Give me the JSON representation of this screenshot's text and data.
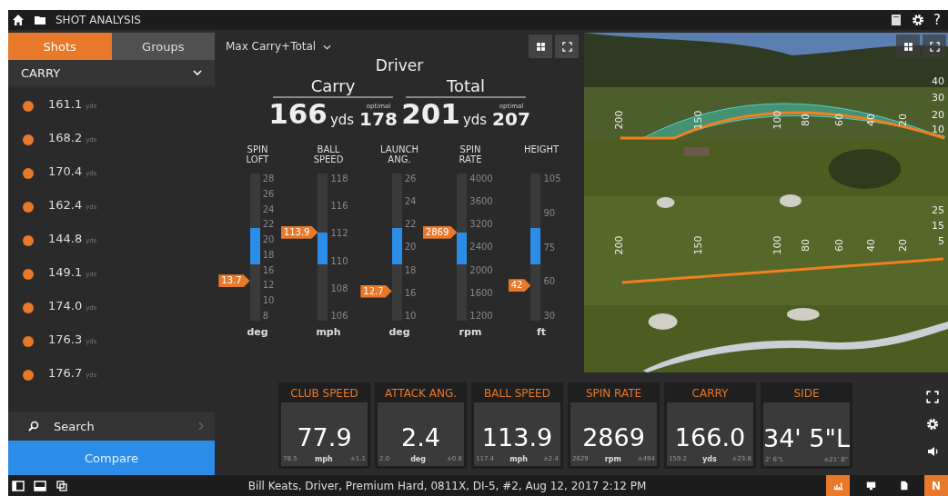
{
  "top_bar": {
    "title": "SHOT ANALYSIS",
    "help": "?"
  },
  "sidebar": {
    "tabs": [
      {
        "label": "Shots",
        "selected": true
      },
      {
        "label": "Groups",
        "selected": false
      }
    ],
    "metric": "CARRY",
    "shots": [
      {
        "value": "161.1",
        "unit": "yds",
        "color": "#e8782a"
      },
      {
        "value": "168.2",
        "unit": "yds",
        "color": "#e8782a"
      },
      {
        "value": "170.4",
        "unit": "yds",
        "color": "#e8782a"
      },
      {
        "value": "162.4",
        "unit": "yds",
        "color": "#e8782a"
      },
      {
        "value": "144.8",
        "unit": "yds",
        "color": "#e8782a"
      },
      {
        "value": "149.1",
        "unit": "yds",
        "color": "#e8782a"
      },
      {
        "value": "174.0",
        "unit": "yds",
        "color": "#e8782a"
      },
      {
        "value": "176.3",
        "unit": "yds",
        "color": "#e8782a"
      },
      {
        "value": "176.7",
        "unit": "yds",
        "color": "#e8782a"
      }
    ],
    "search": "Search",
    "compare": "Compare"
  },
  "analysis": {
    "dropdown": "Max Carry+Total",
    "club": "Driver",
    "results": [
      {
        "label": "Carry",
        "value": "166",
        "unit": "yds",
        "optimal_label": "optimal",
        "optimal": "178"
      },
      {
        "label": "Total",
        "value": "201",
        "unit": "yds",
        "optimal_label": "optimal",
        "optimal": "207"
      }
    ],
    "gauges": [
      {
        "label": "SPIN LOFT",
        "unit": "deg",
        "reading": "13.7",
        "level": 0.27,
        "band_top": {
          "level": 0.63
        },
        "band_bottom": {
          "level": 0.38
        },
        "ticks": [
          "28",
          "26",
          "24",
          "22",
          "20",
          "18",
          "16",
          "12",
          "10",
          "8"
        ]
      },
      {
        "label": "BALL SPEED",
        "unit": "mph",
        "reading": "113.9",
        "level": 0.6,
        "band_top": {
          "level": 0.6
        },
        "band_bottom": {
          "level": 0.38
        },
        "ticks": [
          "118",
          "116",
          "112",
          "110",
          "108",
          "106"
        ]
      },
      {
        "label": "LAUNCH ANG.",
        "unit": "deg",
        "reading": "12.7",
        "level": 0.2,
        "band_top": {
          "level": 0.63
        },
        "band_bottom": {
          "level": 0.38
        },
        "ticks": [
          "26",
          "24",
          "22",
          "20",
          "18",
          "16",
          "10"
        ]
      },
      {
        "label": "SPIN RATE",
        "unit": "rpm",
        "reading": "2869",
        "level": 0.6,
        "band_top": {
          "level": 0.6
        },
        "band_bottom": {
          "level": 0.38
        },
        "ticks": [
          "4000",
          "3600",
          "3200",
          "2400",
          "2000",
          "1600",
          "1200"
        ]
      },
      {
        "label": "HEIGHT",
        "unit": "ft",
        "reading": "42",
        "level": 0.24,
        "band_top": {
          "level": 0.63
        },
        "band_bottom": {
          "level": 0.38
        },
        "ticks": [
          "105",
          "90",
          "75",
          "60",
          "30"
        ]
      }
    ]
  },
  "course_view": {
    "kind": "picture",
    "side_view": {
      "distances": [
        "200",
        "150",
        "100",
        "80",
        "60",
        "40",
        "20"
      ],
      "heights": [
        "40",
        "30",
        "20",
        "10"
      ]
    },
    "top_view": {
      "distances": [
        "200",
        "150",
        "100",
        "80",
        "60",
        "40",
        "20"
      ],
      "offsets": [
        "25",
        "15",
        "5"
      ]
    }
  },
  "tiles": [
    {
      "title": "CLUB SPEED",
      "value": "77.9",
      "low": "78.5",
      "unit": "mph",
      "spread": "±1.1"
    },
    {
      "title": "ATTACK ANG.",
      "value": "2.4",
      "low": "2.0",
      "unit": "deg",
      "spread": "±0.8"
    },
    {
      "title": "BALL SPEED",
      "value": "113.9",
      "low": "117.4",
      "unit": "mph",
      "spread": "±2.4"
    },
    {
      "title": "SPIN RATE",
      "value": "2869",
      "low": "2629",
      "unit": "rpm",
      "spread": "±494"
    },
    {
      "title": "CARRY",
      "value": "166.0",
      "low": "159.2",
      "unit": "yds",
      "spread": "±23.8"
    },
    {
      "title": "SIDE",
      "value": "34' 5\"L",
      "low": "2' 6\"L",
      "spread": "±21' 8\""
    }
  ],
  "status_bar": {
    "text": "Bill Keats, Driver, Premium Hard, 0811X, DI-5, #2, Aug 12, 2017 2:12 PM",
    "badge": "N"
  }
}
